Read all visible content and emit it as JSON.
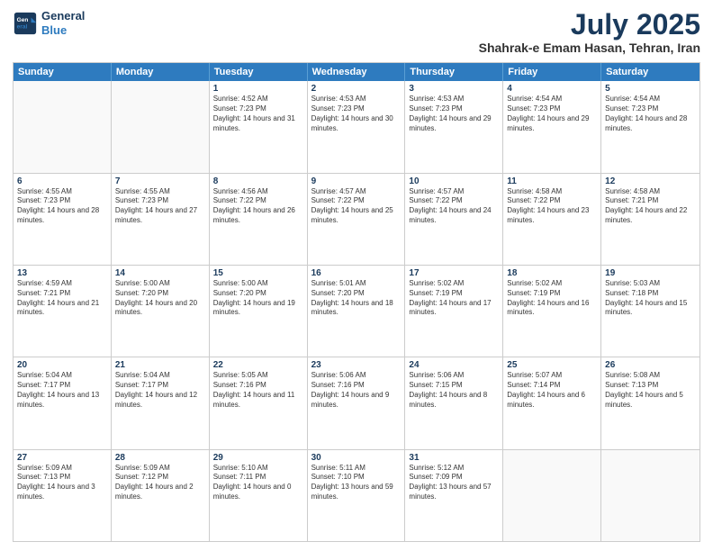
{
  "header": {
    "logo_line1": "General",
    "logo_line2": "Blue",
    "month": "July 2025",
    "location": "Shahrak-e Emam Hasan, Tehran, Iran"
  },
  "days_of_week": [
    "Sunday",
    "Monday",
    "Tuesday",
    "Wednesday",
    "Thursday",
    "Friday",
    "Saturday"
  ],
  "weeks": [
    [
      {
        "day": "",
        "empty": true
      },
      {
        "day": "",
        "empty": true
      },
      {
        "day": "1",
        "rise": "4:52 AM",
        "set": "7:23 PM",
        "daylight": "14 hours and 31 minutes."
      },
      {
        "day": "2",
        "rise": "4:53 AM",
        "set": "7:23 PM",
        "daylight": "14 hours and 30 minutes."
      },
      {
        "day": "3",
        "rise": "4:53 AM",
        "set": "7:23 PM",
        "daylight": "14 hours and 29 minutes."
      },
      {
        "day": "4",
        "rise": "4:54 AM",
        "set": "7:23 PM",
        "daylight": "14 hours and 29 minutes."
      },
      {
        "day": "5",
        "rise": "4:54 AM",
        "set": "7:23 PM",
        "daylight": "14 hours and 28 minutes."
      }
    ],
    [
      {
        "day": "6",
        "rise": "4:55 AM",
        "set": "7:23 PM",
        "daylight": "14 hours and 28 minutes."
      },
      {
        "day": "7",
        "rise": "4:55 AM",
        "set": "7:23 PM",
        "daylight": "14 hours and 27 minutes."
      },
      {
        "day": "8",
        "rise": "4:56 AM",
        "set": "7:22 PM",
        "daylight": "14 hours and 26 minutes."
      },
      {
        "day": "9",
        "rise": "4:57 AM",
        "set": "7:22 PM",
        "daylight": "14 hours and 25 minutes."
      },
      {
        "day": "10",
        "rise": "4:57 AM",
        "set": "7:22 PM",
        "daylight": "14 hours and 24 minutes."
      },
      {
        "day": "11",
        "rise": "4:58 AM",
        "set": "7:22 PM",
        "daylight": "14 hours and 23 minutes."
      },
      {
        "day": "12",
        "rise": "4:58 AM",
        "set": "7:21 PM",
        "daylight": "14 hours and 22 minutes."
      }
    ],
    [
      {
        "day": "13",
        "rise": "4:59 AM",
        "set": "7:21 PM",
        "daylight": "14 hours and 21 minutes."
      },
      {
        "day": "14",
        "rise": "5:00 AM",
        "set": "7:20 PM",
        "daylight": "14 hours and 20 minutes."
      },
      {
        "day": "15",
        "rise": "5:00 AM",
        "set": "7:20 PM",
        "daylight": "14 hours and 19 minutes."
      },
      {
        "day": "16",
        "rise": "5:01 AM",
        "set": "7:20 PM",
        "daylight": "14 hours and 18 minutes."
      },
      {
        "day": "17",
        "rise": "5:02 AM",
        "set": "7:19 PM",
        "daylight": "14 hours and 17 minutes."
      },
      {
        "day": "18",
        "rise": "5:02 AM",
        "set": "7:19 PM",
        "daylight": "14 hours and 16 minutes."
      },
      {
        "day": "19",
        "rise": "5:03 AM",
        "set": "7:18 PM",
        "daylight": "14 hours and 15 minutes."
      }
    ],
    [
      {
        "day": "20",
        "rise": "5:04 AM",
        "set": "7:17 PM",
        "daylight": "14 hours and 13 minutes."
      },
      {
        "day": "21",
        "rise": "5:04 AM",
        "set": "7:17 PM",
        "daylight": "14 hours and 12 minutes."
      },
      {
        "day": "22",
        "rise": "5:05 AM",
        "set": "7:16 PM",
        "daylight": "14 hours and 11 minutes."
      },
      {
        "day": "23",
        "rise": "5:06 AM",
        "set": "7:16 PM",
        "daylight": "14 hours and 9 minutes."
      },
      {
        "day": "24",
        "rise": "5:06 AM",
        "set": "7:15 PM",
        "daylight": "14 hours and 8 minutes."
      },
      {
        "day": "25",
        "rise": "5:07 AM",
        "set": "7:14 PM",
        "daylight": "14 hours and 6 minutes."
      },
      {
        "day": "26",
        "rise": "5:08 AM",
        "set": "7:13 PM",
        "daylight": "14 hours and 5 minutes."
      }
    ],
    [
      {
        "day": "27",
        "rise": "5:09 AM",
        "set": "7:13 PM",
        "daylight": "14 hours and 3 minutes."
      },
      {
        "day": "28",
        "rise": "5:09 AM",
        "set": "7:12 PM",
        "daylight": "14 hours and 2 minutes."
      },
      {
        "day": "29",
        "rise": "5:10 AM",
        "set": "7:11 PM",
        "daylight": "14 hours and 0 minutes."
      },
      {
        "day": "30",
        "rise": "5:11 AM",
        "set": "7:10 PM",
        "daylight": "13 hours and 59 minutes."
      },
      {
        "day": "31",
        "rise": "5:12 AM",
        "set": "7:09 PM",
        "daylight": "13 hours and 57 minutes."
      },
      {
        "day": "",
        "empty": true
      },
      {
        "day": "",
        "empty": true
      }
    ]
  ]
}
